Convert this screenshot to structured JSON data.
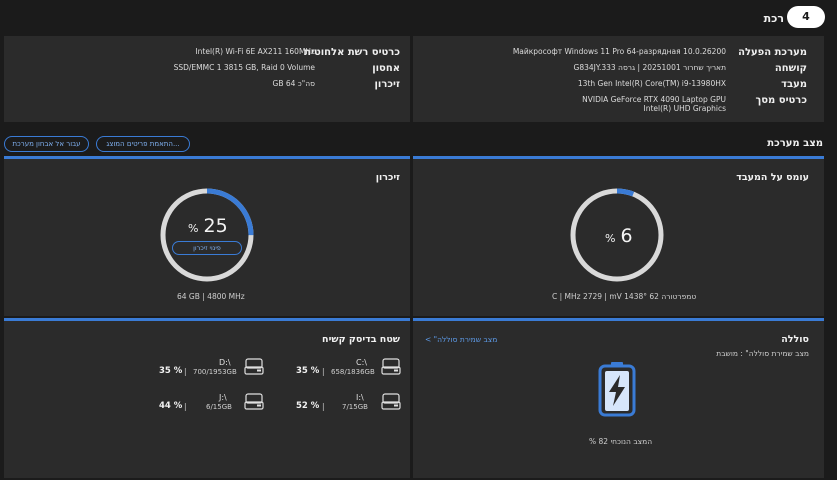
{
  "header": {
    "title_suffix": "רכת",
    "logo_text": "4"
  },
  "system_info": {
    "os_label": "מערכת הפעלה",
    "os_value": "Майкрософт Windows 11 Pro 64-разрядная 10.0.26200",
    "hw_label": "קושחה",
    "hw_value": "תאריך שחרור 20251001 | גרסה G834JY.333",
    "cpu_label": "מעבד",
    "cpu_value": "13th Gen Intel(R) Core(TM) i9-13980HX",
    "gpu_label": "כרטיס מסך",
    "gpu_value_1": "NVIDIA GeForce RTX 4090 Laptop GPU",
    "gpu_value_2": "Intel(R) UHD Graphics",
    "net_label": "כרטיס רשת אלחוטית",
    "net_value": "Intel(R) Wi-Fi 6E AX211 160MHz",
    "storage_label": "אחסון",
    "storage_value": "SSD/EMMC 1    3815 GB, Raid 0 Volume",
    "mem_label": "זיכרון",
    "mem_value": "סה\"כ 64 GB"
  },
  "status": {
    "section_title": "מצב מערכת",
    "btn_match": "התאמת פריטים המוצג...",
    "btn_storage": "עבור אל אבחון מערכת",
    "cpu": {
      "title": "עומס על המעבד",
      "percent": "6",
      "percent_value": 6,
      "pct_sign": "%",
      "details": "טמפרטורה 62 °C  |  MHz 2729  |  mV 1438"
    },
    "memory": {
      "title": "זיכרון",
      "percent": "25",
      "percent_value": 25,
      "pct_sign": "%",
      "free_button": "פינוי זיכרון",
      "details": "64 GB  |  4800 MHz"
    },
    "battery": {
      "title": "סוללה",
      "link": "מצב שמירת סוללה\" >",
      "mode_text": "מצב שמירת סוללה\" : מושבת",
      "current_state": "המצב הנוכחי 82 %"
    },
    "disk": {
      "title": "שטח בדיסק קשיח",
      "drives": [
        {
          "name": "C:\\",
          "size": "658/1836GB",
          "percent": "35 %"
        },
        {
          "name": "D:\\",
          "size": "700/1953GB",
          "percent": "35 %"
        },
        {
          "name": "I:\\",
          "size": "7/15GB",
          "percent": "52 %"
        },
        {
          "name": "J:\\",
          "size": "6/15GB",
          "percent": "44 %"
        }
      ]
    }
  },
  "colors": {
    "accent": "#3a7bd5",
    "panel": "#2b2b2b",
    "background": "#1b1b1b",
    "ring_track": "#d9d9d9"
  }
}
